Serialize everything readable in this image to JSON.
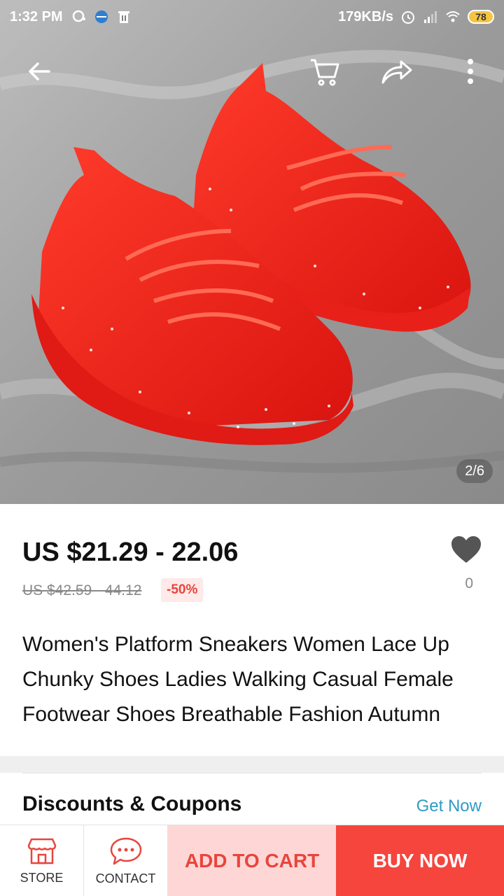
{
  "status_bar": {
    "time": "1:32 PM",
    "network_speed": "179KB/s",
    "battery": "78",
    "icons": [
      "chat-bubble-icon",
      "browser-icon",
      "trash-icon",
      "alarm-icon",
      "signal-icon",
      "wifi-icon",
      "battery-icon"
    ]
  },
  "image_viewer": {
    "counter": "2/6",
    "top_icons": [
      "back-arrow-icon",
      "cart-icon",
      "share-icon",
      "more-vertical-icon"
    ]
  },
  "product": {
    "price": "US $21.29 - 22.06",
    "original_price": "US $42.59 - 44.12",
    "discount": "-50%",
    "wishlist_count": "0",
    "title": "Women's Platform Sneakers Women Lace Up Chunky Shoes Ladies Walking Casual Female Footwear Shoes Breathable Fashion Autumn"
  },
  "coupons": {
    "label": "Discounts & Coupons",
    "action": "Get Now"
  },
  "bottom_bar": {
    "store_label": "STORE",
    "contact_label": "CONTACT",
    "add_to_cart": "ADD TO CART",
    "buy_now": "BUY NOW"
  },
  "colors": {
    "accent_red": "#f5453d",
    "cart_bg": "#ffd6d6",
    "link_blue": "#2e9bc4",
    "discount_bg": "#ffe9e9"
  }
}
